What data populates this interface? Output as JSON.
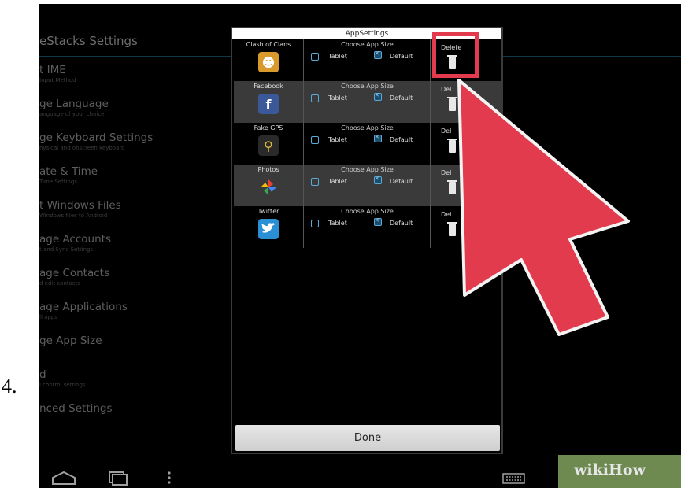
{
  "step_number": "4.",
  "background_settings": {
    "title": "eStacks Settings",
    "items": [
      {
        "title": "t IME",
        "subtitle": "Input Method"
      },
      {
        "title": "ge Language",
        "subtitle": "anguage of your choice"
      },
      {
        "title": "ge Keyboard Settings",
        "subtitle": "hysical and onscreen keyboard"
      },
      {
        "title": "ate & Time",
        "subtitle": "Time Settings"
      },
      {
        "title": "t Windows Files",
        "subtitle": "Windows files to Android"
      },
      {
        "title": "age Accounts",
        "subtitle": "t and Sync Settings"
      },
      {
        "title": "age Contacts",
        "subtitle": "d edit contacts"
      },
      {
        "title": "age Applications",
        "subtitle": "ll apps"
      },
      {
        "title": "ge App Size",
        "subtitle": ""
      },
      {
        "title": "d",
        "subtitle": "l control settings"
      },
      {
        "title": "nced Settings",
        "subtitle": ""
      }
    ]
  },
  "dialog": {
    "title": "AppSettings",
    "size_column_title": "Choose App Size",
    "option_tablet": "Tablet",
    "option_default": "Default",
    "delete_label": "Delete",
    "delete_label_short": "Del",
    "done_label": "Done",
    "apps": [
      {
        "name": "Clash of Clans",
        "icon": "clash-of-clans-icon",
        "color": "#d89a2c"
      },
      {
        "name": "Facebook",
        "icon": "facebook-icon",
        "color": "#3b5998"
      },
      {
        "name": "Fake GPS",
        "icon": "fake-gps-icon",
        "color": "#2a2a2a"
      },
      {
        "name": "Photos",
        "icon": "photos-icon",
        "color": "#4a4a4a"
      },
      {
        "name": "Twitter",
        "icon": "twitter-icon",
        "color": "#2b8fd3"
      }
    ]
  },
  "watermark": "wikiHow",
  "colors": {
    "highlight": "#e23b4e",
    "accent_checkbox": "#5aa9d6"
  }
}
